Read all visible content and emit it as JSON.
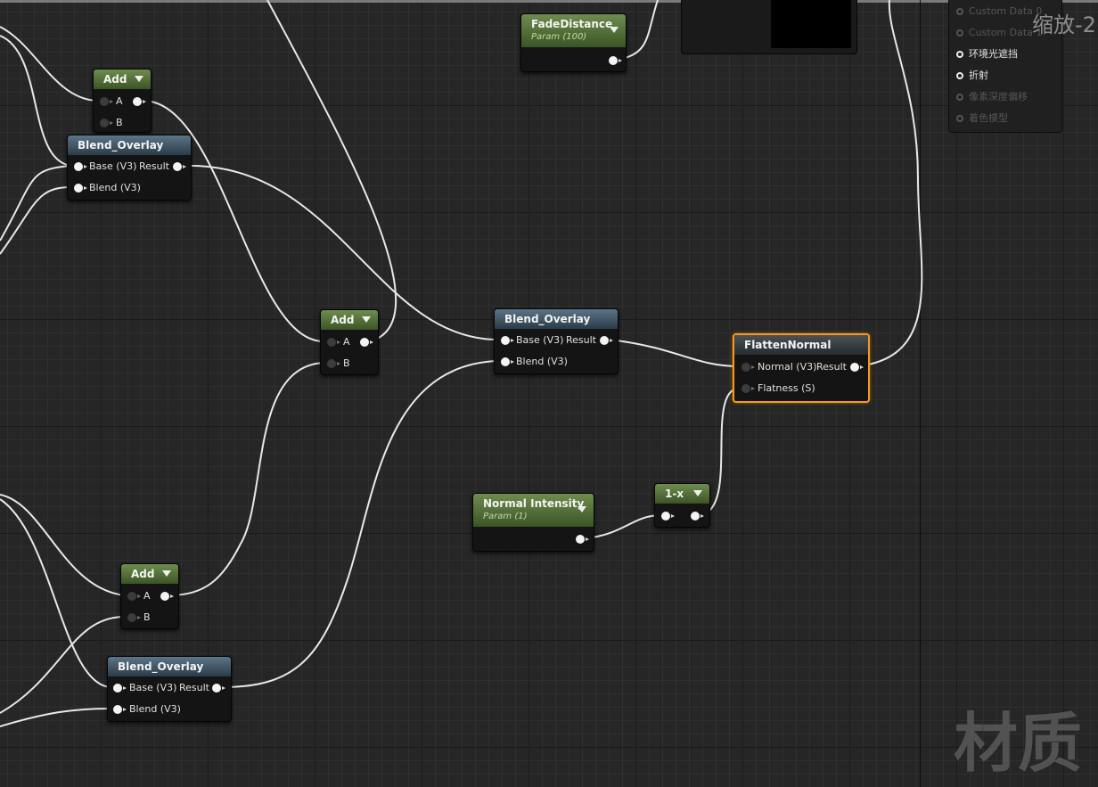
{
  "output_panel": {
    "items": [
      {
        "label": "Custom Data 0",
        "active": false
      },
      {
        "label": "Custom Data 1",
        "active": false
      },
      {
        "label": "环境光遮挡",
        "active": true
      },
      {
        "label": "折射",
        "active": true
      },
      {
        "label": "像素深度偏移",
        "active": false
      },
      {
        "label": "着色模型",
        "active": false
      }
    ]
  },
  "zoom_label": "缩放-2",
  "watermark": "材质",
  "nodes": {
    "fade_distance": {
      "title": "FadeDistance",
      "subtitle": "Param (100)"
    },
    "add1": {
      "title": "Add",
      "pin_a": "A",
      "pin_b": "B"
    },
    "blend1": {
      "title": "Blend_Overlay",
      "pin_base": "Base (V3)",
      "pin_result": "Result",
      "pin_blend": "Blend (V3)"
    },
    "add2": {
      "title": "Add",
      "pin_a": "A",
      "pin_b": "B"
    },
    "blend2": {
      "title": "Blend_Overlay",
      "pin_base": "Base (V3)",
      "pin_result": "Result",
      "pin_blend": "Blend (V3)"
    },
    "flatten": {
      "title": "FlattenNormal",
      "pin_normal": "Normal (V3)",
      "pin_result": "Result",
      "pin_flatness": "Flatness (S)"
    },
    "normal_intensity": {
      "title": "Normal Intensity",
      "subtitle": "Param (1)"
    },
    "one_minus": {
      "title": "1-x"
    },
    "add3": {
      "title": "Add",
      "pin_a": "A",
      "pin_b": "B"
    },
    "blend3": {
      "title": "Blend_Overlay",
      "pin_base": "Base (V3)",
      "pin_result": "Result",
      "pin_blend": "Blend (V3)"
    }
  }
}
